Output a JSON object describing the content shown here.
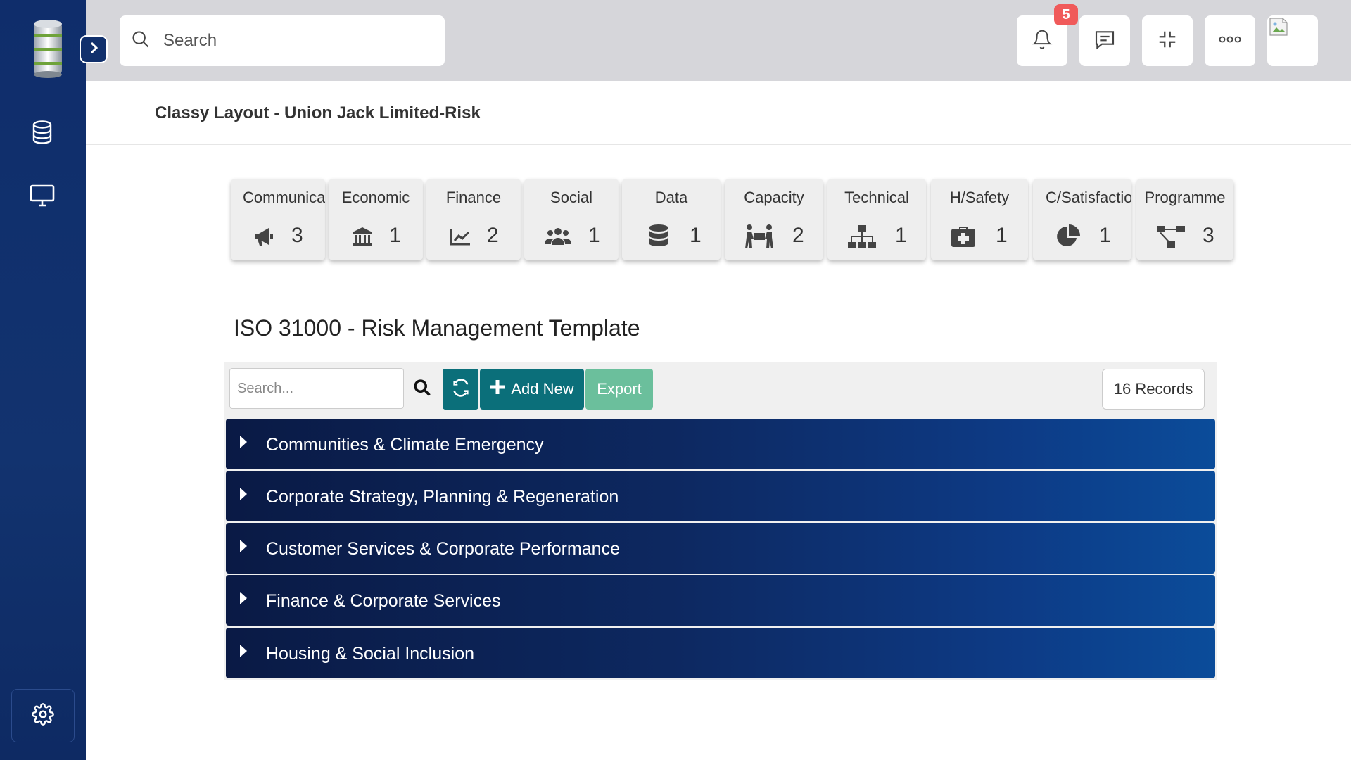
{
  "topbar": {
    "search_placeholder": "Search",
    "notification_count": "5"
  },
  "page": {
    "title": "Classy Layout - Union Jack Limited-Risk"
  },
  "categories": [
    {
      "label": "Communications",
      "count": "3",
      "icon": "megaphone-icon"
    },
    {
      "label": "Economic",
      "count": "1",
      "icon": "bank-icon"
    },
    {
      "label": "Finance",
      "count": "2",
      "icon": "chart-line-icon"
    },
    {
      "label": "Social",
      "count": "1",
      "icon": "users-icon"
    },
    {
      "label": "Data",
      "count": "1",
      "icon": "database-icon"
    },
    {
      "label": "Capacity",
      "count": "2",
      "icon": "people-carry-icon"
    },
    {
      "label": "Technical",
      "count": "1",
      "icon": "sitemap-icon"
    },
    {
      "label": "H/Safety",
      "count": "1",
      "icon": "medkit-icon"
    },
    {
      "label": "C/Satisfaction",
      "count": "1",
      "icon": "pie-chart-icon"
    },
    {
      "label": "Programme",
      "count": "3",
      "icon": "project-diagram-icon"
    }
  ],
  "section": {
    "title": "ISO 31000 - Risk Management Template"
  },
  "grid": {
    "search_placeholder": "Search...",
    "add_label": "Add New",
    "export_label": "Export",
    "records_label": "16 Records",
    "groups": [
      "Communities & Climate Emergency",
      "Corporate Strategy, Planning & Regeneration",
      "Customer Services & Corporate Performance",
      "Finance & Corporate Services",
      "Housing & Social Inclusion"
    ]
  },
  "colors": {
    "sidebar": "#0f2d6b",
    "topbar": "#d6d6da",
    "teal_button": "#0b6f7a",
    "export_button": "#6bbf9c",
    "badge": "#f05a5a",
    "group_row_start": "#0a1a45",
    "group_row_end": "#0b4c9a"
  }
}
